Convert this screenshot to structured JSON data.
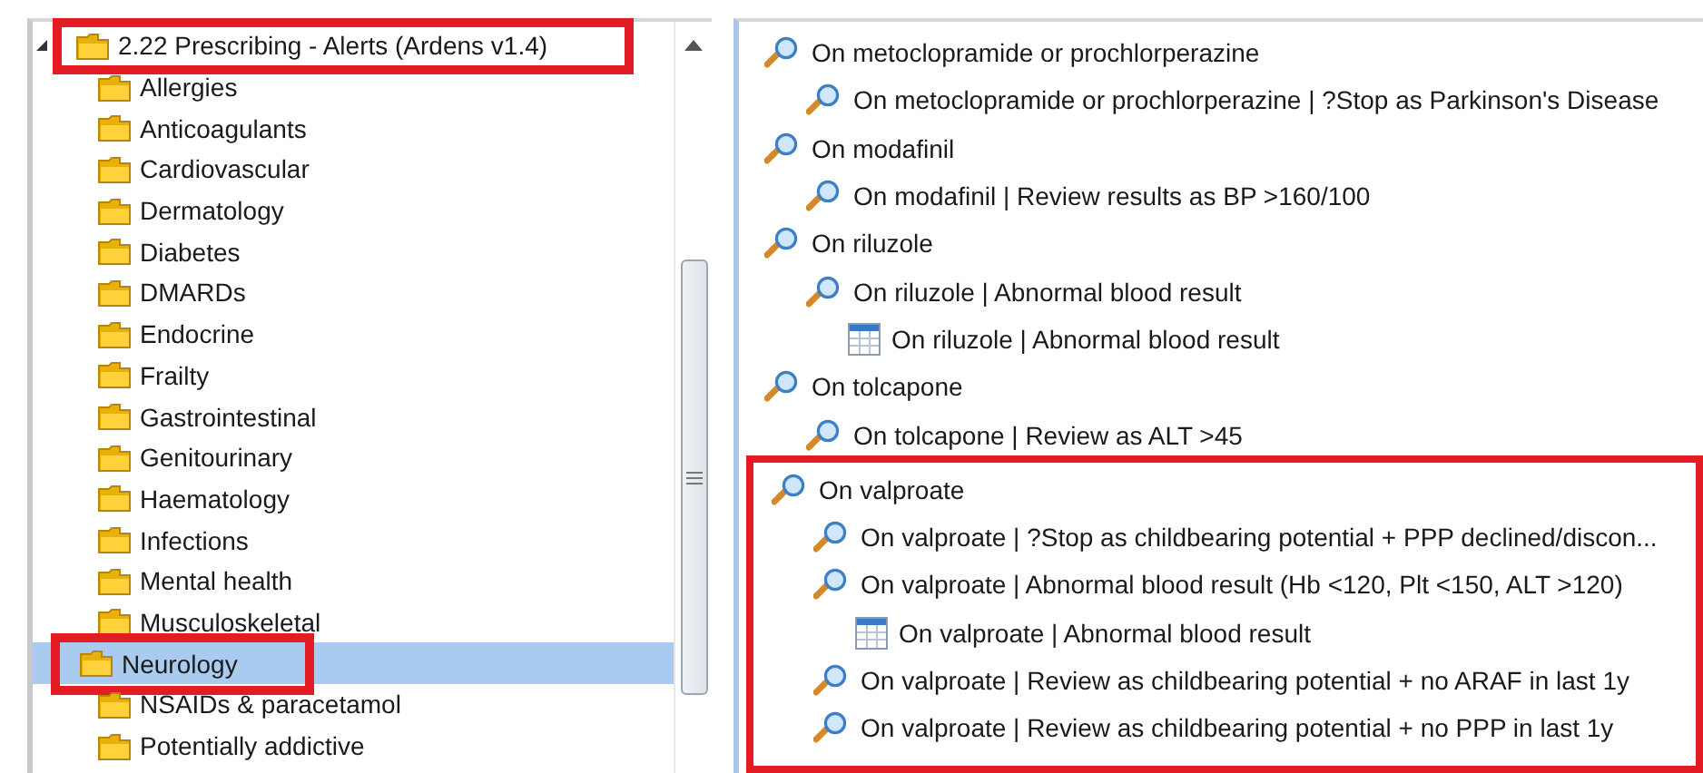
{
  "folder_tree": {
    "root": {
      "label": "2.22 Prescribing - Alerts (Ardens v1.4)",
      "selected": false,
      "highlighted": true,
      "expanded": true
    },
    "items": [
      {
        "label": "Allergies",
        "selected": false,
        "highlighted": false
      },
      {
        "label": "Anticoagulants",
        "selected": false,
        "highlighted": false
      },
      {
        "label": "Cardiovascular",
        "selected": false,
        "highlighted": false
      },
      {
        "label": "Dermatology",
        "selected": false,
        "highlighted": false
      },
      {
        "label": "Diabetes",
        "selected": false,
        "highlighted": false
      },
      {
        "label": "DMARDs",
        "selected": false,
        "highlighted": false
      },
      {
        "label": "Endocrine",
        "selected": false,
        "highlighted": false
      },
      {
        "label": "Frailty",
        "selected": false,
        "highlighted": false
      },
      {
        "label": "Gastrointestinal",
        "selected": false,
        "highlighted": false
      },
      {
        "label": "Genitourinary",
        "selected": false,
        "highlighted": false
      },
      {
        "label": "Haematology",
        "selected": false,
        "highlighted": false
      },
      {
        "label": "Infections",
        "selected": false,
        "highlighted": false
      },
      {
        "label": "Mental health",
        "selected": false,
        "highlighted": false
      },
      {
        "label": "Musculoskeletal",
        "selected": false,
        "highlighted": false
      },
      {
        "label": "Neurology",
        "selected": true,
        "highlighted": true
      },
      {
        "label": "NSAIDs & paracetamol",
        "selected": false,
        "highlighted": false
      },
      {
        "label": "Potentially addictive",
        "selected": false,
        "highlighted": false
      }
    ]
  },
  "search_tree": [
    {
      "kind": "search",
      "label": "On metoclopramide or prochlorperazine",
      "highlighted": false,
      "children": [
        {
          "kind": "search",
          "label": "On metoclopramide or prochlorperazine | ?Stop as Parkinson's Disease"
        }
      ]
    },
    {
      "kind": "search",
      "label": "On modafinil",
      "highlighted": false,
      "children": [
        {
          "kind": "search",
          "label": "On modafinil | Review results as BP >160/100"
        }
      ]
    },
    {
      "kind": "search",
      "label": "On riluzole",
      "highlighted": false,
      "children": [
        {
          "kind": "search",
          "label": "On riluzole | Abnormal blood result",
          "children": [
            {
              "kind": "table",
              "label": "On riluzole | Abnormal blood result"
            }
          ]
        }
      ]
    },
    {
      "kind": "search",
      "label": "On tolcapone",
      "highlighted": false,
      "children": [
        {
          "kind": "search",
          "label": "On tolcapone | Review as ALT >45"
        }
      ]
    },
    {
      "kind": "search",
      "label": "On valproate",
      "highlighted": true,
      "children": [
        {
          "kind": "search",
          "label": "On valproate | ?Stop as childbearing potential + PPP declined/discon..."
        },
        {
          "kind": "search",
          "label": "On valproate | Abnormal blood result (Hb <120, Plt <150, ALT >120)",
          "children": [
            {
              "kind": "table",
              "label": "On valproate | Abnormal blood result"
            }
          ]
        },
        {
          "kind": "search",
          "label": "On valproate | Review as childbearing potential + no ARAF in last 1y"
        },
        {
          "kind": "search",
          "label": "On valproate | Review as childbearing potential + no PPP in last 1y"
        }
      ]
    }
  ]
}
